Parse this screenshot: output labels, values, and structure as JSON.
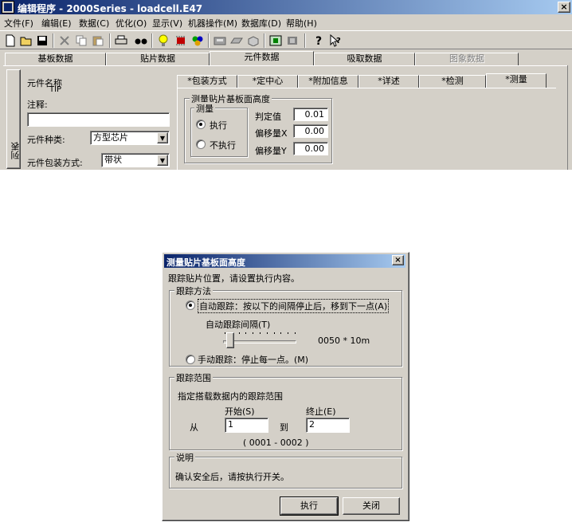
{
  "app": {
    "title": "编辑程序 - 2000Series - loadcell.E47",
    "menu": [
      "文件(F)",
      "编辑(E)",
      "数据(C)",
      "优化(O)",
      "显示(V)",
      "机器操作(M)",
      "数据库(D)",
      "帮助(H)"
    ],
    "main_tabs": [
      {
        "label": "基板数据",
        "state": "normal"
      },
      {
        "label": "贴片数据",
        "state": "normal"
      },
      {
        "label": "元件数据",
        "state": "active"
      },
      {
        "label": "吸取数据",
        "state": "normal"
      },
      {
        "label": "图象数据",
        "state": "disabled"
      }
    ],
    "side_tab_label": "列表",
    "part_name_label": "元件名称",
    "part_name_value": "TIP",
    "comment_label": "注释:",
    "comment_value": "",
    "part_type_label": "元件种类:",
    "part_type_value": "方型芯片",
    "package_label": "元件包装方式:",
    "package_value": "带状",
    "sub_tabs": [
      "*包装方式",
      "*定中心",
      "*附加信息",
      "*详述",
      "*检测",
      "*测量"
    ],
    "active_sub_tab": "*测量",
    "measure_group_title": "测量贴片基板面高度",
    "measure_subgroup_title": "测量",
    "radio_execute": "执行",
    "radio_not_execute": "不执行",
    "radio_selected": "执行",
    "judge_label": "判定值",
    "judge_value": "0.01",
    "offset_x_label": "偏移量X",
    "offset_x_value": "0.00",
    "offset_y_label": "偏移量Y",
    "offset_y_value": "0.00"
  },
  "dialog": {
    "title": "测量贴片基板面高度",
    "close_glyph": "×",
    "intro": "跟踪贴片位置，请设置执行内容。",
    "method_group_title": "跟踪方法",
    "auto_track_label": "自动跟踪：按以下的间隔停止后，移到下一点(A)",
    "auto_interval_label": "自动跟踪间隔(T)",
    "interval_readout": "0050 * 10m",
    "slider_level_fraction": 0.05,
    "manual_track_label": "手动跟踪：停止每一点。(M)",
    "selected_method": "auto",
    "range_group_title": "跟踪范围",
    "range_desc": "指定搭载数据内的跟踪范围",
    "start_label": "开始(S)",
    "end_label": "终止(E)",
    "from_label": "从",
    "to_label": "到",
    "start_value": "1",
    "end_value": "2",
    "range_hint": "( 0001 - 0002 )",
    "note_group_title": "说明",
    "note_text": "确认安全后，请按执行开关。",
    "execute_button": "执行",
    "close_button": "关闭"
  },
  "toolbar_icons": [
    "new-file-icon",
    "open-folder-icon",
    "save-icon",
    "delete-icon",
    "copy-icon",
    "paste-icon",
    "print-icon",
    "binoculars-icon",
    "lightbulb-icon",
    "chip-icon",
    "components-icon",
    "machine-icon",
    "conveyor-icon",
    "camera-icon",
    "nozzle-icon",
    "stop-icon",
    "help-icon",
    "context-help-icon"
  ],
  "colors": {
    "title_active": "#0a246a",
    "title_gradient_end": "#a6caf0",
    "face": "#d4d0c8"
  }
}
